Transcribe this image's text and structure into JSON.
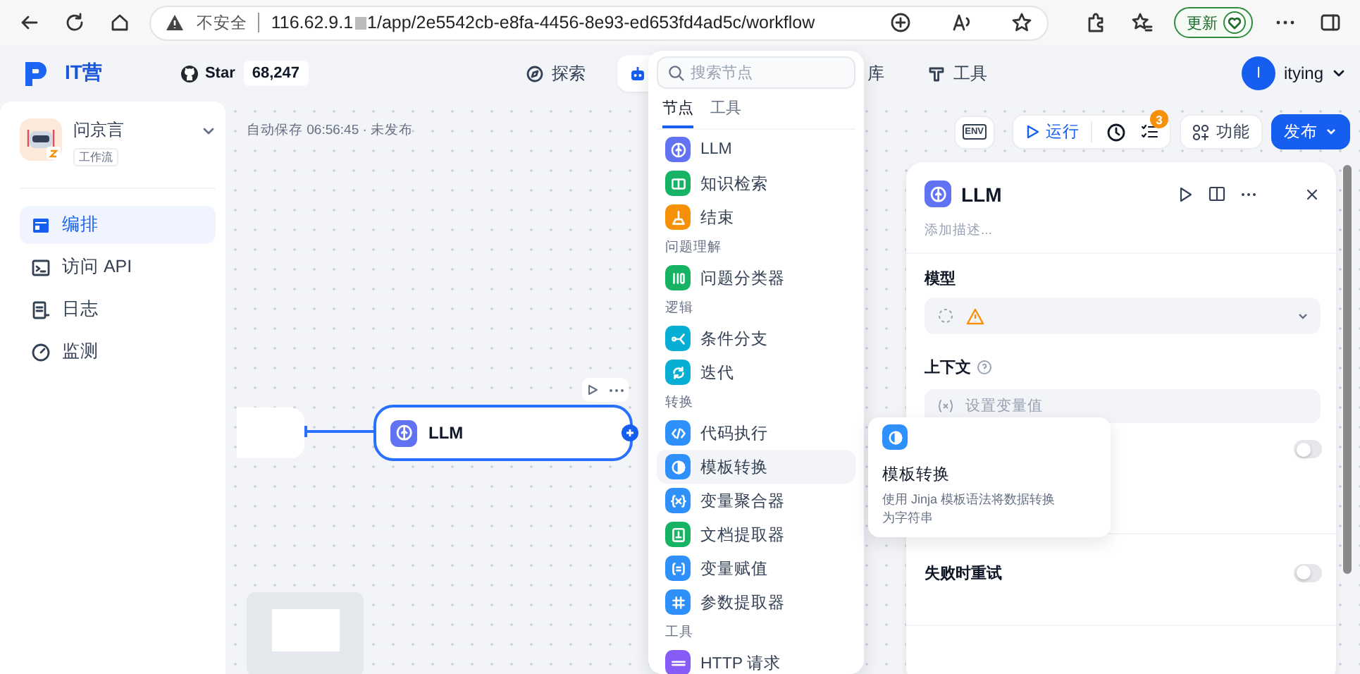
{
  "browser": {
    "security": "不安全",
    "url_start": "116.62.9.1",
    "url_end": "1/app/2e5542cb-e8fa-4456-8e93-ed653fd4ad5c/workflow",
    "update_button": "更新"
  },
  "header": {
    "logo": "IT营",
    "github": {
      "label": "Star",
      "count": "68,247"
    },
    "nav": [
      {
        "kind": "explore",
        "label": "探索",
        "selected": false
      },
      {
        "kind": "studio",
        "selected": true
      },
      {
        "kind": "library",
        "label": "库",
        "selected": false
      },
      {
        "kind": "tools",
        "label": "工具",
        "selected": false
      }
    ],
    "user": {
      "initial": "I",
      "name": "itying"
    }
  },
  "sidebar": {
    "app_name": "问京言",
    "app_type": "工作流",
    "items": [
      {
        "kind": "layout",
        "label": "编排",
        "selected": true
      },
      {
        "kind": "terminal",
        "label": "访问 API",
        "selected": false
      },
      {
        "kind": "log",
        "label": "日志",
        "selected": false
      },
      {
        "kind": "gauge",
        "label": "监测",
        "selected": false
      }
    ]
  },
  "canvas": {
    "autosave": "自动保存 06:56:45 · 未发布",
    "toolbar": {
      "env": "ENV",
      "run": "运行",
      "checklist_badge": "3",
      "features": "功能",
      "publish": "发布"
    },
    "node": {
      "title": "LLM"
    }
  },
  "node_menu": {
    "search": {
      "placeholder": "搜索节点"
    },
    "tabs": [
      {
        "label": "节点",
        "selected": true
      },
      {
        "label": "工具",
        "selected": false
      }
    ],
    "groups": [
      {
        "items": [
          {
            "kind": "llm",
            "label": "LLM",
            "color": "#6172f3",
            "selected": false
          },
          {
            "kind": "knowledge",
            "label": "知识检索",
            "color": "#16b364",
            "selected": false
          },
          {
            "kind": "end",
            "label": "结束",
            "color": "#f79009",
            "selected": false
          }
        ]
      },
      {
        "title": "问题理解",
        "items": [
          {
            "kind": "classifier",
            "label": "问题分类器",
            "color": "#16b364",
            "selected": false
          }
        ]
      },
      {
        "title": "逻辑",
        "items": [
          {
            "kind": "branch",
            "label": "条件分支",
            "color": "#06aed4",
            "selected": false
          },
          {
            "kind": "iteration",
            "label": "迭代",
            "color": "#06aed4",
            "selected": false
          }
        ]
      },
      {
        "title": "转换",
        "items": [
          {
            "kind": "code",
            "label": "代码执行",
            "color": "#2e90fa",
            "selected": false
          },
          {
            "kind": "template",
            "label": "模板转换",
            "color": "#2e90fa",
            "selected": true
          },
          {
            "kind": "aggregator",
            "label": "变量聚合器",
            "color": "#2e90fa",
            "selected": false
          },
          {
            "kind": "doc",
            "label": "文档提取器",
            "color": "#16b364",
            "selected": false
          },
          {
            "kind": "assign",
            "label": "变量赋值",
            "color": "#2e90fa",
            "selected": false
          },
          {
            "kind": "params",
            "label": "参数提取器",
            "color": "#2e90fa",
            "selected": false
          }
        ]
      },
      {
        "title": "工具",
        "items": [
          {
            "kind": "http",
            "label": "HTTP 请求",
            "color": "#875bf7",
            "selected": false
          }
        ]
      }
    ]
  },
  "tooltip": {
    "kind": "template",
    "title": "模板转换",
    "description": "使用 Jinja 模板语法将数据转换为字符串"
  },
  "panel": {
    "title": "LLM",
    "description_placeholder": "添加描述...",
    "model_label": "模型",
    "context_label": "上下文",
    "context_placeholder": "设置变量值",
    "toggles": [
      {
        "on": false
      },
      {
        "label": "失败时重试",
        "on": false
      }
    ]
  }
}
